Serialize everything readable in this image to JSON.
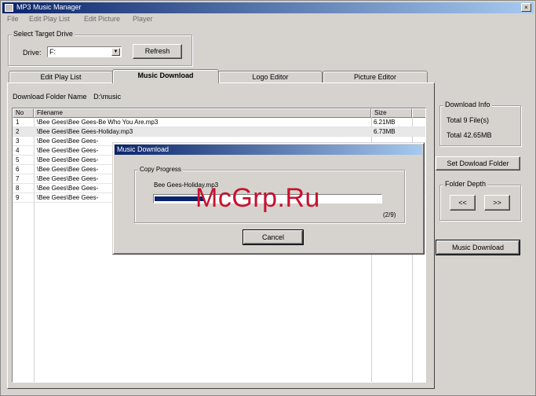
{
  "window": {
    "title": "MP3 Music Manager",
    "close_glyph": "×"
  },
  "menu": [
    {
      "label": "File"
    },
    {
      "label": "Edit Play List"
    },
    {
      "label": "Edit Picture"
    },
    {
      "label": "Player"
    }
  ],
  "drive": {
    "group_label": "Select Target Drive",
    "drive_label": "Drive",
    "drive_value": "F:",
    "refresh_label": "Refresh"
  },
  "tabs": [
    {
      "label": "Edit Play List",
      "active": false
    },
    {
      "label": "Music Download",
      "active": true
    },
    {
      "label": "Logo Editor",
      "active": false
    },
    {
      "label": "Picture Editor",
      "active": false
    }
  ],
  "download_folder": {
    "label": "Download Folder Name",
    "value": "D:\\music"
  },
  "list": {
    "columns": {
      "no": "No",
      "filename": "Filename",
      "size": "Size"
    },
    "rows": [
      {
        "no": "1",
        "filename": "\\Bee Gees\\Bee Gees-Be Who You Are.mp3",
        "size": "6.21MB"
      },
      {
        "no": "2",
        "filename": "\\Bee Gees\\Bee Gees-Holiday.mp3",
        "size": "6.73MB"
      },
      {
        "no": "3",
        "filename": "\\Bee Gees\\Bee Gees-",
        "size": ""
      },
      {
        "no": "4",
        "filename": "\\Bee Gees\\Bee Gees-",
        "size": ""
      },
      {
        "no": "5",
        "filename": "\\Bee Gees\\Bee Gees-",
        "size": ""
      },
      {
        "no": "6",
        "filename": "\\Bee Gees\\Bee Gees-",
        "size": ""
      },
      {
        "no": "7",
        "filename": "\\Bee Gees\\Bee Gees-",
        "size": ""
      },
      {
        "no": "8",
        "filename": "\\Bee Gees\\Bee Gees-",
        "size": ""
      },
      {
        "no": "9",
        "filename": "\\Bee Gees\\Bee Gees-",
        "size": ""
      }
    ]
  },
  "download_info": {
    "group_label": "Download Info",
    "total_files": "Total 9 File(s)",
    "total_size": "Total 42.65MB"
  },
  "set_folder_label": "Set Dowload Folder",
  "folder_depth": {
    "group_label": "Folder Depth",
    "prev": "<<",
    "next": ">>"
  },
  "music_download_button": "Music Download",
  "dialog": {
    "title": "Music Download",
    "group_label": "Copy Progress",
    "current_file": "Bee Gees-Holiday.mp3",
    "progress_fraction": 0.22,
    "counter": "(2/9)",
    "cancel_label": "Cancel"
  },
  "watermark": "McGrp.Ru"
}
